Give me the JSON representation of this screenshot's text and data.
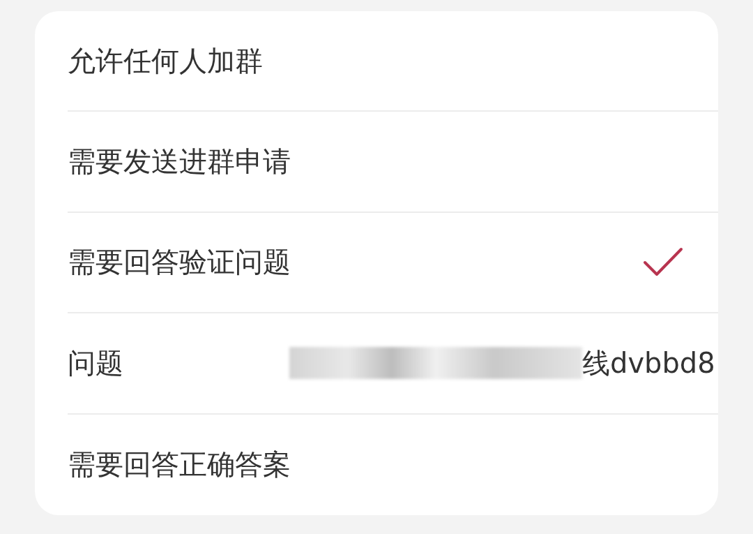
{
  "options": [
    {
      "kind": "option",
      "label": "允许任何人加群",
      "selected": false
    },
    {
      "kind": "option",
      "label": "需要发送进群申请",
      "selected": false
    },
    {
      "kind": "option",
      "label": "需要回答验证问题",
      "selected": true
    },
    {
      "kind": "field",
      "label": "问题",
      "value": "线dvbbd8",
      "redacted": true
    },
    {
      "kind": "option",
      "label": "需要回答正确答案",
      "selected": false
    }
  ]
}
